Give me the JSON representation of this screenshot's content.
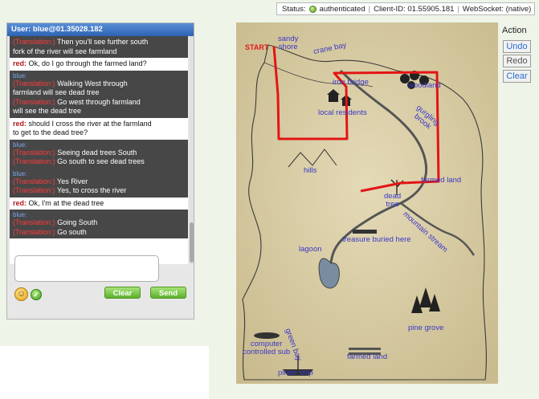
{
  "status_bar": {
    "status_label": "Status:",
    "status_value": "authenticated",
    "client_id": "Client-ID: 01.55905.181",
    "websocket": "WebSocket: (native)"
  },
  "chat": {
    "header": "User: blue@01.35028.182",
    "messages": [
      {
        "type": "blue",
        "sender": "",
        "lines": [
          {
            "tr": "(Translation:)",
            "text": "Then you'll see further south"
          },
          {
            "tr": "",
            "text": "fork of the river will see farmland"
          }
        ]
      },
      {
        "type": "red",
        "sender": "red:",
        "lines": [
          {
            "tr": "",
            "text": "Ok, do I go through the farmed land?"
          }
        ]
      },
      {
        "type": "blue",
        "sender": "blue:",
        "lines": [
          {
            "tr": "(Translation:)",
            "text": "Walking West through"
          },
          {
            "tr": "",
            "text": "farmland will see dead tree"
          },
          {
            "tr": "(Translation:)",
            "text": "Go west through farmland"
          },
          {
            "tr": "",
            "text": "will see the dead tree"
          }
        ]
      },
      {
        "type": "red",
        "sender": "red:",
        "lines": [
          {
            "tr": "",
            "text": "should I cross the river at the farmland"
          },
          {
            "tr": "",
            "text": "to get to the dead tree?"
          }
        ]
      },
      {
        "type": "blue",
        "sender": "blue:",
        "lines": [
          {
            "tr": "(Translation:)",
            "text": "Seeing dead trees South"
          },
          {
            "tr": "(Translation:)",
            "text": "Go south to see dead trees"
          }
        ]
      },
      {
        "type": "blue",
        "sender": "blue:",
        "lines": [
          {
            "tr": "(Translation:)",
            "text": "Yes River"
          },
          {
            "tr": "(Translation:)",
            "text": "Yes, to cross the river"
          }
        ]
      },
      {
        "type": "red",
        "sender": "red:",
        "lines": [
          {
            "tr": "",
            "text": "Ok, I'm at the dead tree"
          }
        ]
      },
      {
        "type": "blue",
        "sender": "blue:",
        "lines": [
          {
            "tr": "(Translation:)",
            "text": "Going South"
          },
          {
            "tr": "(Translation:)",
            "text": "Go south"
          }
        ]
      }
    ],
    "clear_label": "Clear",
    "send_label": "Send",
    "input_value": ""
  },
  "map": {
    "labels": {
      "start": "START",
      "sandy_shore": "sandy\nshore",
      "crane_bay": "crane bay",
      "iron_bridge": "iron bridge",
      "woodland": "woodland",
      "local_residents": "local residents",
      "gurgling_brook": "gurgling\nbrook",
      "hills": "hills",
      "farmed_land_1": "farmed land",
      "dead_tree": "dead\ntree",
      "mountain_stream": "mountain stream",
      "lagoon": "lagoon",
      "treasure": "treasure buried here",
      "pine_grove": "pine grove",
      "computer_sub": "computer\ncontrolled sub",
      "green_bay": "green bay",
      "farmed_land_2": "farmed land",
      "pirate_ship": "pirate ship"
    }
  },
  "tools": {
    "title": "Action",
    "undo": "Undo",
    "redo": "Redo",
    "clear": "Clear"
  },
  "colors": {
    "route": "#e31515",
    "label": "#3a37c8",
    "chat_header": "#2c63b5",
    "translation": "#ff3b3b"
  }
}
